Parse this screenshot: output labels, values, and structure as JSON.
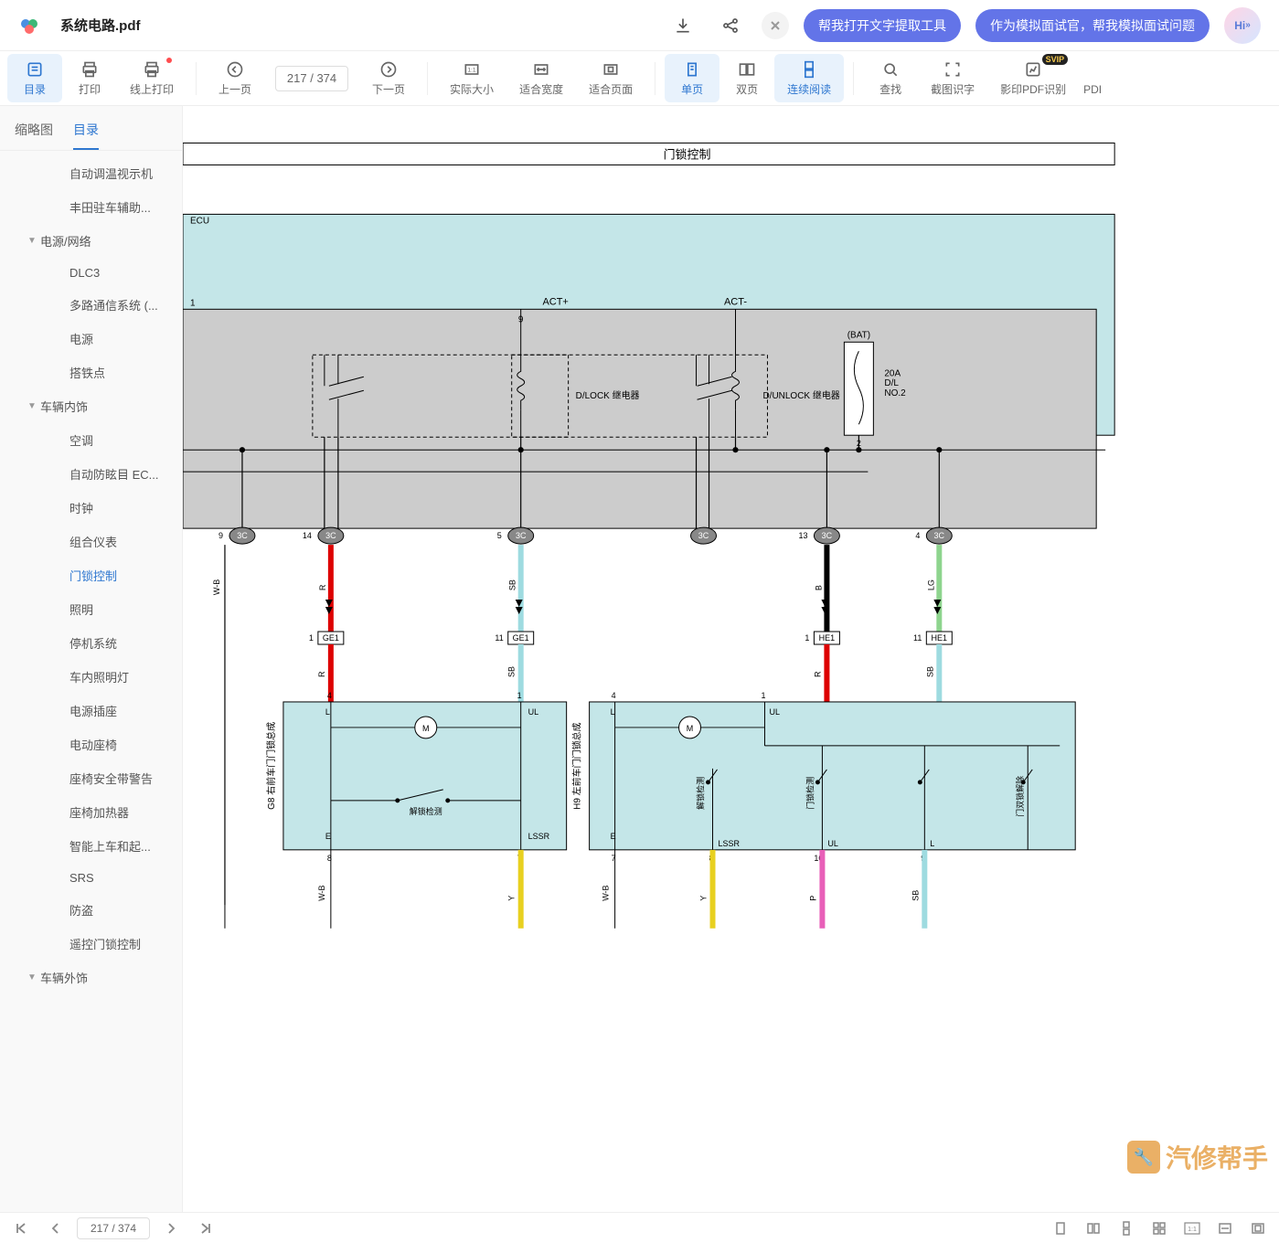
{
  "header": {
    "file_title": "系统电路.pdf",
    "hi_badge": "Hi",
    "pills": [
      "帮我打开文字提取工具",
      "作为模拟面试官，帮我模拟面试问题"
    ]
  },
  "toolbar": {
    "items": [
      {
        "id": "toc",
        "label": "目录",
        "active": true
      },
      {
        "id": "print",
        "label": "打印"
      },
      {
        "id": "online-print",
        "label": "线上打印",
        "dot": true
      },
      {
        "id": "prev",
        "label": "上一页"
      },
      {
        "id": "page-input",
        "value": "217 / 374"
      },
      {
        "id": "next",
        "label": "下一页"
      },
      {
        "id": "actual-size",
        "label": "实际大小"
      },
      {
        "id": "fit-width",
        "label": "适合宽度"
      },
      {
        "id": "fit-page",
        "label": "适合页面"
      },
      {
        "id": "single-page",
        "label": "单页",
        "active": true
      },
      {
        "id": "facing",
        "label": "双页"
      },
      {
        "id": "continuous",
        "label": "连续阅读",
        "active": true
      },
      {
        "id": "find",
        "label": "查找"
      },
      {
        "id": "snip-ocr",
        "label": "截图识字"
      },
      {
        "id": "ocr-pdf",
        "label": "影印PDF识别",
        "svip": true
      },
      {
        "id": "pdf",
        "label": "PDI"
      }
    ]
  },
  "sidebar": {
    "tabs": {
      "thumb": "缩略图",
      "toc": "目录"
    },
    "items": [
      {
        "label": "自动调温视示机",
        "level": 2,
        "truncated": true
      },
      {
        "label": "丰田驻车辅助...",
        "level": 2
      },
      {
        "label": "电源/网络",
        "level": 1,
        "collapsible": true
      },
      {
        "label": "DLC3",
        "level": 2
      },
      {
        "label": "多路通信系统 (...",
        "level": 2
      },
      {
        "label": "电源",
        "level": 2
      },
      {
        "label": "搭铁点",
        "level": 2
      },
      {
        "label": "车辆内饰",
        "level": 1,
        "collapsible": true
      },
      {
        "label": "空调",
        "level": 2
      },
      {
        "label": "自动防眩目 EC...",
        "level": 2
      },
      {
        "label": "时钟",
        "level": 2
      },
      {
        "label": "组合仪表",
        "level": 2
      },
      {
        "label": "门锁控制",
        "level": 2,
        "active": true
      },
      {
        "label": "照明",
        "level": 2
      },
      {
        "label": "停机系统",
        "level": 2
      },
      {
        "label": "车内照明灯",
        "level": 2
      },
      {
        "label": "电源插座",
        "level": 2
      },
      {
        "label": "电动座椅",
        "level": 2
      },
      {
        "label": "座椅安全带警告",
        "level": 2
      },
      {
        "label": "座椅加热器",
        "level": 2
      },
      {
        "label": "智能上车和起...",
        "level": 2
      },
      {
        "label": "SRS",
        "level": 2
      },
      {
        "label": "防盗",
        "level": 2
      },
      {
        "label": "遥控门锁控制",
        "level": 2
      },
      {
        "label": "车辆外饰",
        "level": 1,
        "collapsible": true
      }
    ]
  },
  "diagram": {
    "title": "门锁控制",
    "ecu_label": "ECU",
    "labels": {
      "act_plus": "ACT+",
      "act_minus": "ACT-",
      "bat": "(BAT)",
      "fuse": "20A\nD/L\nNO.2",
      "dlock": "D/LOCK\n继电器",
      "dunlock": "D/UNLOCK\n继电器",
      "ge1": "GE1",
      "he1": "HE1",
      "L": "L",
      "UL": "UL",
      "E": "E",
      "LSSR": "LSSR",
      "unlock_detect": "解锁检测",
      "unlock_detect2": "解锁检测",
      "lock_detect": "门锁检测",
      "double_lock": "门双锁解除",
      "g8": "G8 右前车门门锁总成",
      "h9": "H9 左前车门门锁总成"
    },
    "pins": {
      "box1_9": "9",
      "box2_2": "2",
      "c_9": "9",
      "c_14": "14",
      "c_5": "5",
      "c_13": "13",
      "c_4": "4",
      "ge1_1a": "1",
      "ge1_11": "11",
      "he1_1": "1",
      "he1_11": "11",
      "b1_4": "4",
      "b1_1": "1",
      "b2_4": "4",
      "b2_1": "1",
      "b1_8": "8",
      "b1_7": "7",
      "b2_7": "7",
      "b2_8": "8",
      "b2_10": "10",
      "b2_9": "9",
      "3c": "3C"
    },
    "wires": {
      "wb": "W-B",
      "r": "R",
      "sb": "SB",
      "b": "B",
      "lg": "LG",
      "y": "Y",
      "p": "P"
    }
  },
  "bottom": {
    "page": "217 / 374"
  },
  "watermark": "汽修帮手"
}
